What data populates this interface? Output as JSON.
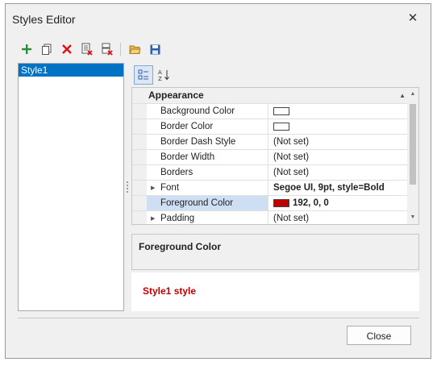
{
  "window": {
    "title": "Styles Editor",
    "close_glyph": "✕"
  },
  "toolbar": {
    "icons": [
      "add-icon",
      "copy-icon",
      "delete-icon",
      "clear-icon",
      "purge-icon",
      "open-icon",
      "save-icon"
    ]
  },
  "styles_list": {
    "items": [
      {
        "label": "Style1",
        "selected": true
      }
    ]
  },
  "property_grid": {
    "toolbar_icons": [
      "categorized-icon",
      "alphabetical-icon"
    ],
    "category": {
      "label": "Appearance",
      "arrow": "▲"
    },
    "rows": [
      {
        "name": "Background Color",
        "value": "",
        "swatch": "#ffffff",
        "bold": false,
        "expandable": false,
        "selected": false
      },
      {
        "name": "Border Color",
        "value": "",
        "swatch": "#ffffff",
        "bold": false,
        "expandable": false,
        "selected": false
      },
      {
        "name": "Border Dash Style",
        "value": "(Not set)",
        "bold": false,
        "expandable": false,
        "selected": false
      },
      {
        "name": "Border Width",
        "value": "(Not set)",
        "bold": false,
        "expandable": false,
        "selected": false
      },
      {
        "name": "Borders",
        "value": "(Not set)",
        "bold": false,
        "expandable": false,
        "selected": false
      },
      {
        "name": "Font",
        "value": "Segoe UI, 9pt, style=Bold",
        "bold": true,
        "expandable": true,
        "selected": false
      },
      {
        "name": "Foreground Color",
        "value": "192, 0, 0",
        "swatch": "#c00000",
        "bold": true,
        "expandable": false,
        "selected": true
      },
      {
        "name": "Padding",
        "value": "(Not set)",
        "bold": false,
        "expandable": true,
        "selected": false
      }
    ]
  },
  "description": {
    "title": "Foreground Color"
  },
  "preview": {
    "text": "Style1 style",
    "color": "#c00000"
  },
  "footer": {
    "close_label": "Close"
  }
}
